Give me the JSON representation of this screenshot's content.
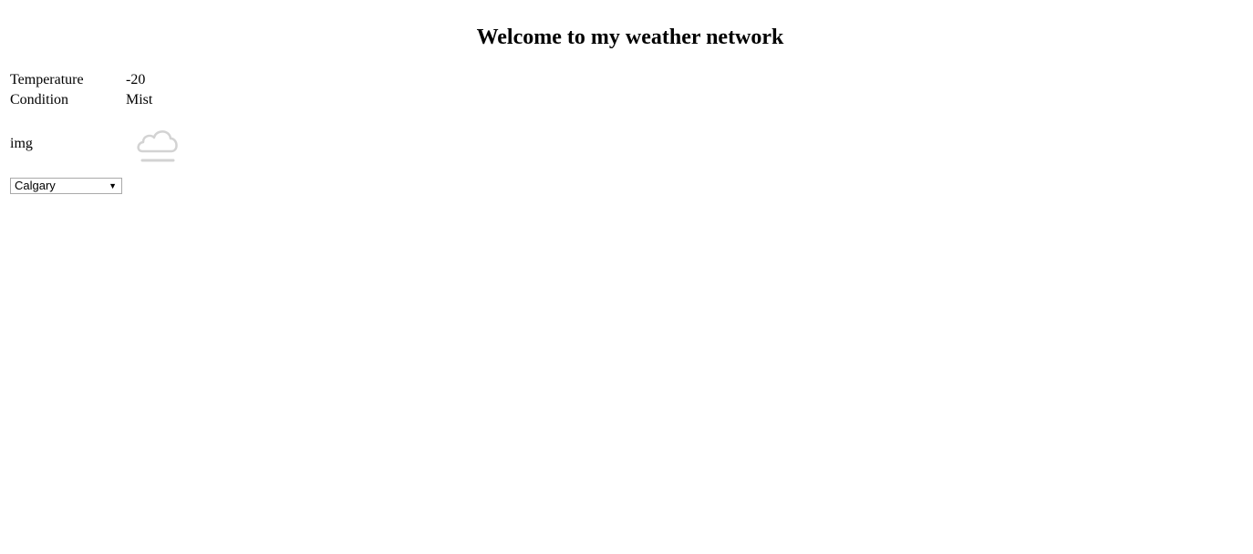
{
  "header": {
    "title": "Welcome to my weather network"
  },
  "weather": {
    "temperature_label": "Temperature",
    "temperature_value": "-20",
    "condition_label": "Condition",
    "condition_value": "Mist",
    "image_label": "img",
    "icon": "cloud-mist-icon",
    "icon_color": "#d3d3d3"
  },
  "city_select": {
    "selected": "Calgary"
  }
}
